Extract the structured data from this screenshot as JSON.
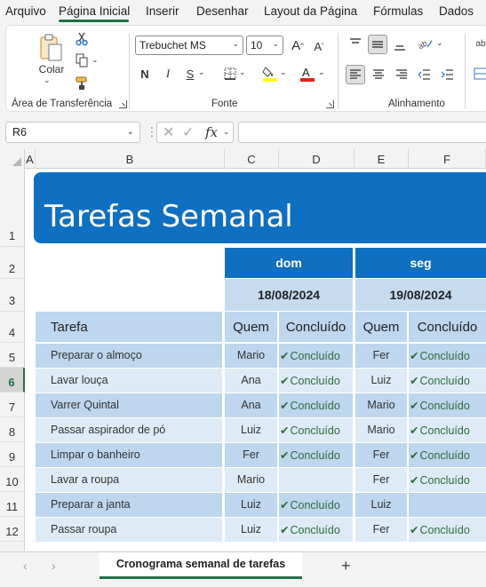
{
  "menu": {
    "tabs": [
      "Arquivo",
      "Página Inicial",
      "Inserir",
      "Desenhar",
      "Layout da Página",
      "Fórmulas",
      "Dados"
    ],
    "active_index": 1
  },
  "ribbon": {
    "clipboard": {
      "paste_label": "Colar",
      "group_label": "Área de Transferência"
    },
    "font": {
      "font_name": "Trebuchet MS",
      "font_size": "10",
      "bold": "N",
      "italic": "I",
      "underline": "S",
      "group_label": "Fonte",
      "fill_color": "#ffff00",
      "font_color": "#e02020"
    },
    "alignment": {
      "group_label": "Alinhamento"
    }
  },
  "formula_bar": {
    "cell_ref": "R6",
    "fx": "fx",
    "value": ""
  },
  "sheet": {
    "columns": [
      "A",
      "B",
      "C",
      "D",
      "E",
      "F"
    ],
    "rows": [
      "1",
      "2",
      "3",
      "4",
      "5",
      "6",
      "7",
      "8",
      "9",
      "10",
      "11",
      "12"
    ],
    "active_row": "6",
    "title": "Tarefas Semanal",
    "days": [
      {
        "name": "dom",
        "date": "18/08/2024"
      },
      {
        "name": "seg",
        "date": "19/08/2024"
      }
    ],
    "headers": {
      "task": "Tarefa",
      "who": "Quem",
      "done": "Concluído"
    },
    "tasks": [
      {
        "task": "Preparar o almoço",
        "who1": "Mario",
        "done1": "Concluído",
        "who2": "Fer",
        "done2": "Concluído"
      },
      {
        "task": "Lavar louça",
        "who1": "Ana",
        "done1": "Concluído",
        "who2": "Luiz",
        "done2": "Concluído"
      },
      {
        "task": "Varrer Quintal",
        "who1": "Ana",
        "done1": "Concluído",
        "who2": "Mario",
        "done2": "Concluído"
      },
      {
        "task": "Passar aspirador de pó",
        "who1": "Luiz",
        "done1": "Concluído",
        "who2": "Mario",
        "done2": "Concluído"
      },
      {
        "task": "Limpar o banheiro",
        "who1": "Fer",
        "done1": "Concluído",
        "who2": "Fer",
        "done2": "Concluído"
      },
      {
        "task": "Lavar a roupa",
        "who1": "Mario",
        "done1": "",
        "who2": "Fer",
        "done2": "Concluído"
      },
      {
        "task": "Preparar a janta",
        "who1": "Luiz",
        "done1": "Concluído",
        "who2": "Luiz",
        "done2": ""
      },
      {
        "task": "Passar roupa",
        "who1": "Luiz",
        "done1": "Concluído",
        "who2": "Fer",
        "done2": "Concluído"
      }
    ],
    "colors": {
      "title_band": "#0f6fc1",
      "date_band": "#c7dbef",
      "row_dark": "#bed6ee",
      "row_light": "#deebf7",
      "done_text": "#2f6b3b"
    }
  },
  "sheet_tabs": {
    "active": "Cronograma semanal de tarefas",
    "add": "+"
  }
}
